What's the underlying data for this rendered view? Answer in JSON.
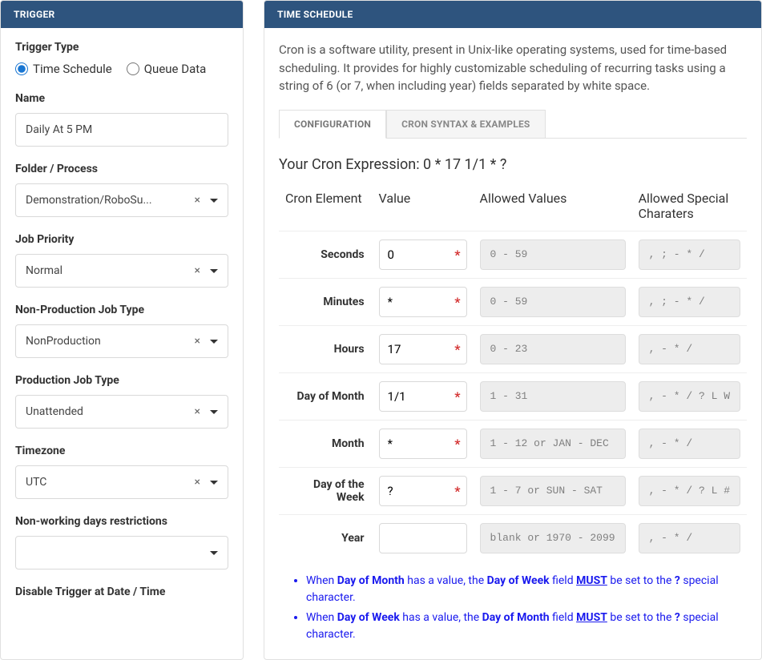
{
  "left": {
    "header": "TRIGGER",
    "trigger_type_label": "Trigger Type",
    "radio_time": "Time Schedule",
    "radio_queue": "Queue Data",
    "name_label": "Name",
    "name_value": "Daily At 5 PM",
    "folder_label": "Folder / Process",
    "folder_value": "Demonstration/RoboSu...",
    "priority_label": "Job Priority",
    "priority_value": "Normal",
    "nonprod_label": "Non-Production Job Type",
    "nonprod_value": "NonProduction",
    "prod_label": "Production Job Type",
    "prod_value": "Unattended",
    "timezone_label": "Timezone",
    "timezone_value": "UTC",
    "nonworking_label": "Non-working days restrictions",
    "nonworking_value": "",
    "disable_label": "Disable Trigger at Date / Time"
  },
  "right": {
    "header": "TIME SCHEDULE",
    "description": "Cron is a software utility, present in Unix-like operating systems, used for time-based scheduling. It provides for highly customizable scheduling of recurring tasks using a string of 6 (or 7, when including year) fields separated by white space.",
    "tabs": {
      "config": "CONFIGURATION",
      "syntax": "CRON SYNTAX & EXAMPLES"
    },
    "cron_expr_label": "Your Cron Expression: ",
    "cron_expr_value": "0 * 17 1/1 * ?",
    "table": {
      "h_element": "Cron Element",
      "h_value": "Value",
      "h_allowed": "Allowed Values",
      "h_special": "Allowed Special Charaters"
    },
    "rows": [
      {
        "label": "Seconds",
        "value": "0",
        "allowed": "0 - 59",
        "special": ", ; - * /",
        "required": true
      },
      {
        "label": "Minutes",
        "value": "*",
        "allowed": "0 - 59",
        "special": ", ; - * /",
        "required": true
      },
      {
        "label": "Hours",
        "value": "17",
        "allowed": "0 - 23",
        "special": ", - * /",
        "required": true
      },
      {
        "label": "Day of Month",
        "value": "1/1",
        "allowed": "1 - 31",
        "special": ", - * / ? L W",
        "required": true
      },
      {
        "label": "Month",
        "value": "*",
        "allowed": "1 - 12 or JAN - DEC",
        "special": ", - * /",
        "required": true
      },
      {
        "label": "Day of the Week",
        "value": "?",
        "allowed": "1 - 7 or SUN - SAT",
        "special": ", - * / ? L #",
        "required": true
      },
      {
        "label": "Year",
        "value": "",
        "allowed": "blank or 1970 - 2099",
        "special": ", - * /",
        "required": false
      }
    ],
    "notes": {
      "n1_a": "When ",
      "n1_b": "Day of Month",
      "n1_c": " has a value, the ",
      "n1_d": "Day of Week",
      "n1_e": " field ",
      "n1_f": "MUST",
      "n1_g": " be set to the ",
      "n1_h": "?",
      "n1_i": " special character.",
      "n2_a": "When ",
      "n2_b": "Day of Week",
      "n2_c": " has a value, the ",
      "n2_d": "Day of Month",
      "n2_e": " field ",
      "n2_f": "MUST",
      "n2_g": " be set to the ",
      "n2_h": "?",
      "n2_i": " special character."
    }
  }
}
